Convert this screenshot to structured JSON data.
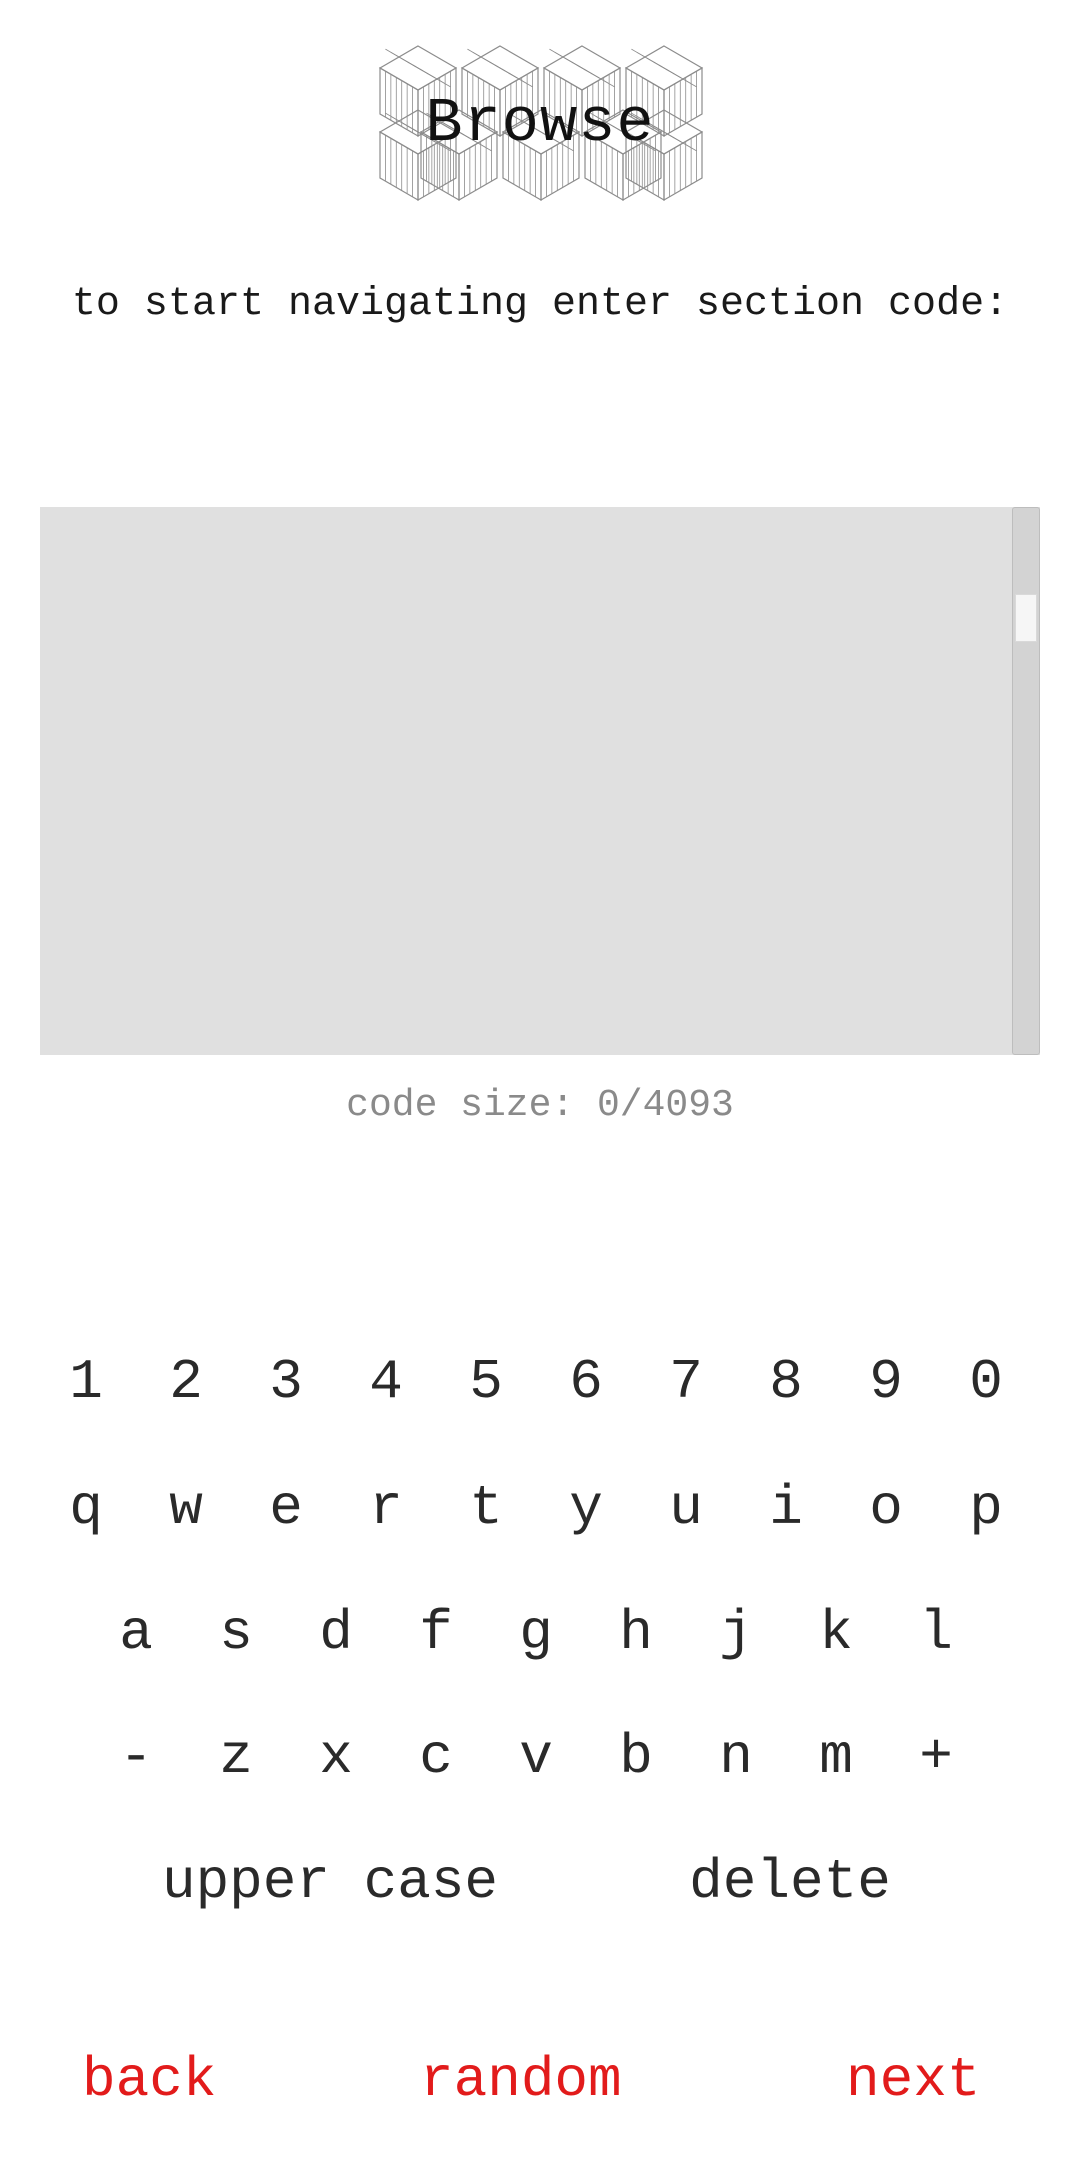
{
  "header": {
    "title": "Browse"
  },
  "instructions": "to start navigating enter section code:",
  "code": {
    "value": "",
    "size_label": "code size: 0/4093"
  },
  "keyboard": {
    "row1": [
      "1",
      "2",
      "3",
      "4",
      "5",
      "6",
      "7",
      "8",
      "9",
      "0"
    ],
    "row2": [
      "q",
      "w",
      "e",
      "r",
      "t",
      "y",
      "u",
      "i",
      "o",
      "p"
    ],
    "row3": [
      "a",
      "s",
      "d",
      "f",
      "g",
      "h",
      "j",
      "k",
      "l"
    ],
    "row4": [
      "-",
      "z",
      "x",
      "c",
      "v",
      "b",
      "n",
      "m",
      "+"
    ],
    "upper_case": "upper case",
    "delete": "delete"
  },
  "nav": {
    "back": "back",
    "random": "random",
    "next": "next"
  },
  "colors": {
    "nav_link": "#e21b1b",
    "code_area": "#e0e0e0",
    "code_size_text": "#8a8a8a"
  },
  "icons": {
    "logo": "isometric-cubes-logo"
  }
}
